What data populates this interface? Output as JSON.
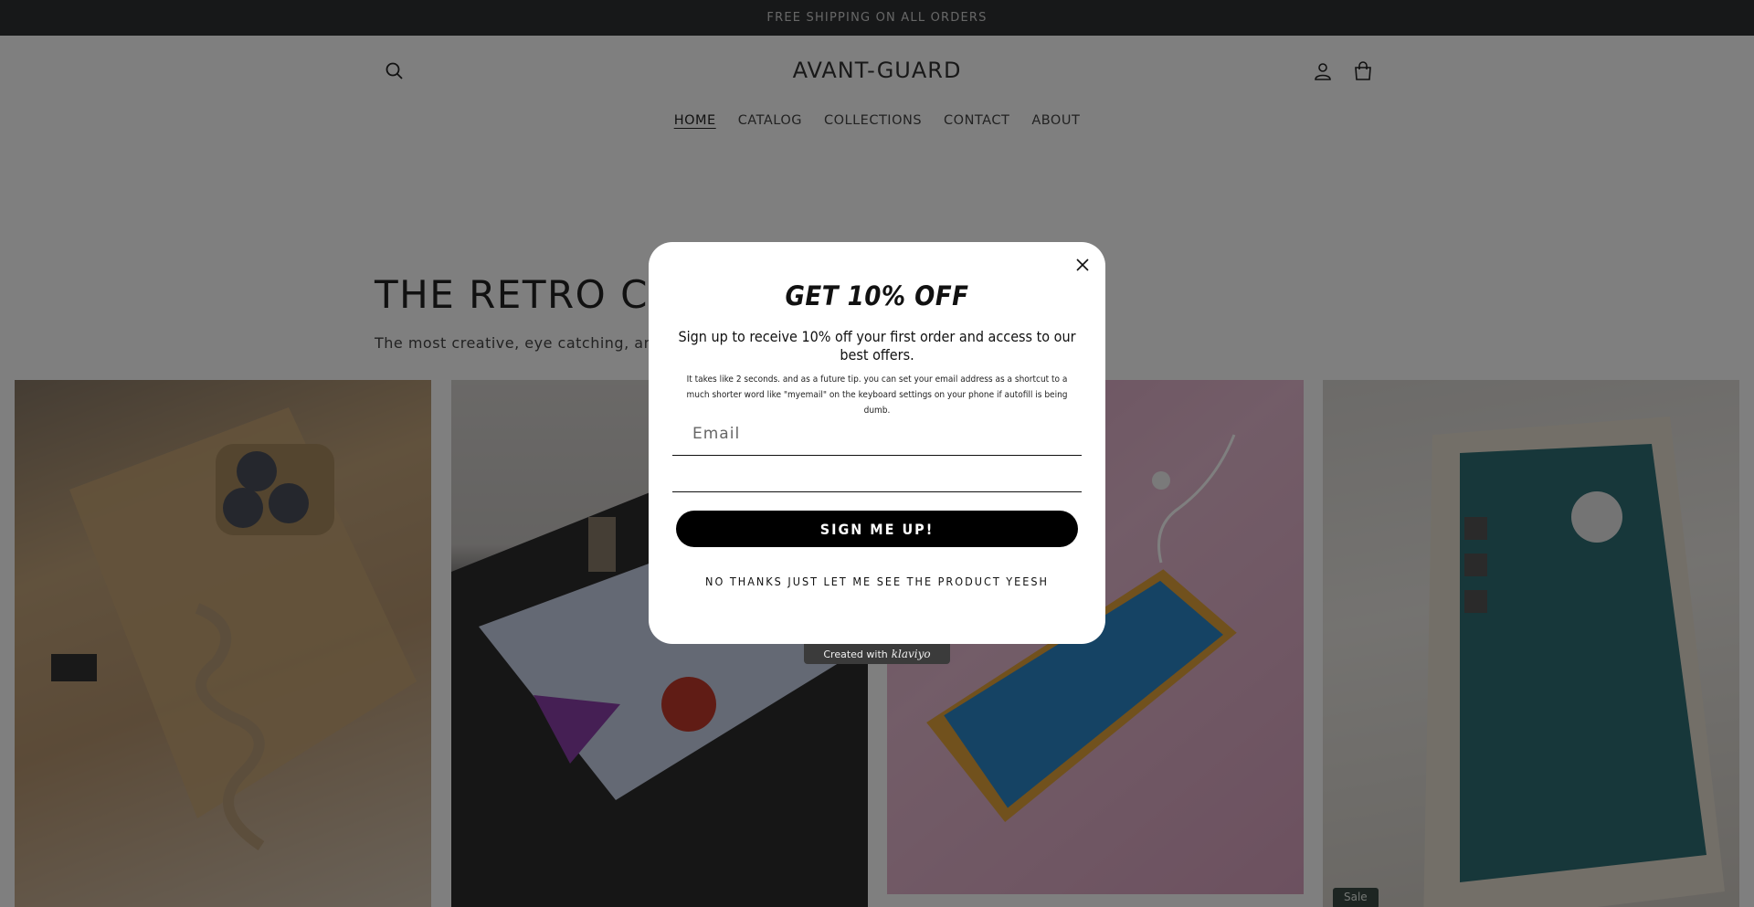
{
  "announcement": "FREE SHIPPING ON ALL ORDERS",
  "header": {
    "logo": "AVANT-GUARD",
    "icons": {
      "search": "search-icon",
      "account": "account-icon",
      "cart": "cart-icon"
    }
  },
  "nav": {
    "items": [
      {
        "label": "HOME",
        "active": true
      },
      {
        "label": "CATALOG"
      },
      {
        "label": "COLLECTIONS"
      },
      {
        "label": "CONTACT"
      },
      {
        "label": "ABOUT"
      }
    ]
  },
  "hero": {
    "title": "THE RETRO COLL",
    "subtitle": "The most creative, eye catching, and ne"
  },
  "products": {
    "sale_badge": "Sale"
  },
  "popup": {
    "title": "GET 10% OFF",
    "lead": "Sign up to receive 10% off your first order and access to our best offers.",
    "fine_print": "It takes like 2 seconds. and as a future tip. you can set your email address as a shortcut to a much shorter word like \"myemail\" on the keyboard settings on your phone if autofill is being dumb.",
    "email_placeholder": "Email",
    "submit_label": "SIGN ME UP!",
    "decline_label": "NO THANKS JUST LET ME SEE THE PRODUCT YEESH",
    "close_icon": "close-icon"
  },
  "branding": {
    "created_with": "Created with",
    "brand": "klaviyo"
  },
  "colors": {
    "announcement_bg": "#2f3133",
    "overlay": "rgba(0,0,0,0.5)",
    "button_bg": "#000000",
    "sale_badge_bg": "#3a4a44"
  }
}
